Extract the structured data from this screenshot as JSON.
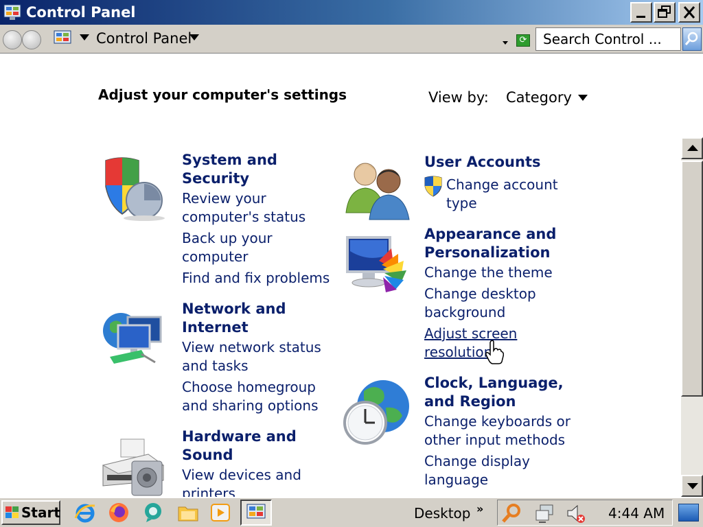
{
  "window": {
    "title": "Control Panel"
  },
  "address_bar": {
    "path": "Control Panel",
    "search_placeholder": "Search Control ..."
  },
  "page": {
    "heading": "Adjust your computer's settings",
    "view_by_label": "View by:",
    "view_by_value": "Category"
  },
  "categories": {
    "system": {
      "title_line1": "System and",
      "title_line2": "Security",
      "links": [
        "Review your",
        "computer's status",
        "Back up your",
        "computer",
        "Find and fix problems"
      ]
    },
    "network": {
      "title_line1": "Network and",
      "title_line2": "Internet",
      "links": [
        "View network status",
        "and tasks",
        "Choose homegroup",
        "and sharing options"
      ]
    },
    "hardware": {
      "title_line1": "Hardware and",
      "title_line2": "Sound",
      "links": [
        "View devices and",
        "printers"
      ]
    },
    "users": {
      "title": "User Accounts",
      "links": [
        "Change account",
        "type"
      ]
    },
    "appearance": {
      "title_line1": "Appearance and",
      "title_line2": "Personalization",
      "links": [
        "Change the theme",
        "Change desktop",
        "background",
        "Adjust screen",
        "resolution"
      ]
    },
    "clock": {
      "title_line1": "Clock, Language,",
      "title_line2": "and Region",
      "links": [
        "Change keyboards or",
        "other input methods",
        "Change display",
        "language"
      ]
    }
  },
  "taskbar": {
    "start_label": "Start",
    "desktop_label": "Desktop",
    "chevron": "»",
    "clock": "4:44 AM"
  }
}
